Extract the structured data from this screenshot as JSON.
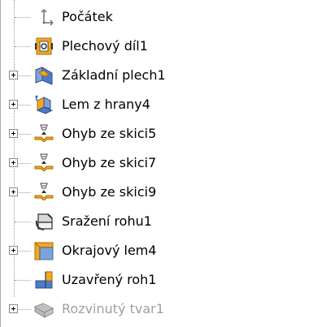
{
  "tree": {
    "items": [
      {
        "label": "Počátek",
        "icon": "origin-icon",
        "expandable": false
      },
      {
        "label": "Plechový díl1",
        "icon": "sheet-metal-icon",
        "expandable": false
      },
      {
        "label": "Základní plech1",
        "icon": "base-flange-icon",
        "expandable": true
      },
      {
        "label": "Lem z hrany4",
        "icon": "edge-flange-icon",
        "expandable": true
      },
      {
        "label": "Ohyb ze skici5",
        "icon": "sketched-bend-icon",
        "expandable": true
      },
      {
        "label": "Ohyb ze skici7",
        "icon": "sketched-bend-icon",
        "expandable": true
      },
      {
        "label": "Ohyb ze skici9",
        "icon": "sketched-bend-icon",
        "expandable": true
      },
      {
        "label": "Sražení rohu1",
        "icon": "break-corner-icon",
        "expandable": false
      },
      {
        "label": "Okrajový lem4",
        "icon": "miter-flange-icon",
        "expandable": true
      },
      {
        "label": "Uzavřený roh1",
        "icon": "closed-corner-icon",
        "expandable": false
      },
      {
        "label": "Rozvinutý tvar1",
        "icon": "flat-pattern-icon",
        "expandable": true,
        "disabled": true
      }
    ]
  }
}
